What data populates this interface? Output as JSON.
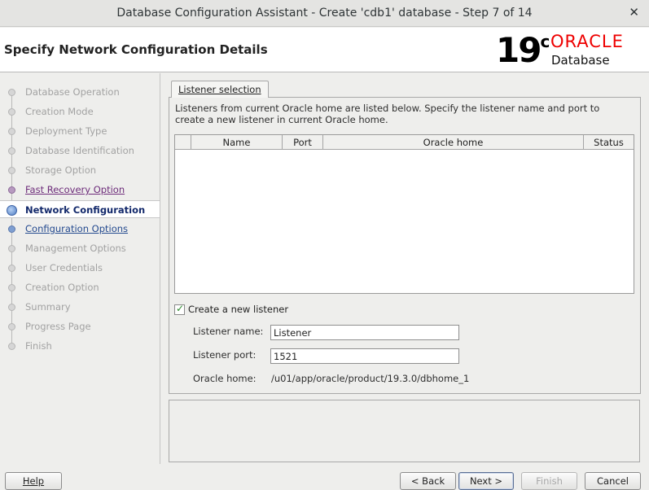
{
  "window": {
    "title": "Database Configuration Assistant - Create 'cdb1' database - Step 7 of 14",
    "close_glyph": "✕"
  },
  "header": {
    "heading": "Specify Network Configuration Details",
    "logo": {
      "version": "19",
      "version_suffix": "c",
      "brand": "ORACLE",
      "product": "Database"
    }
  },
  "nav": {
    "steps": [
      {
        "label": "Database Operation",
        "state": "disabled"
      },
      {
        "label": "Creation Mode",
        "state": "disabled"
      },
      {
        "label": "Deployment Type",
        "state": "disabled"
      },
      {
        "label": "Database Identification",
        "state": "disabled"
      },
      {
        "label": "Storage Option",
        "state": "disabled"
      },
      {
        "label": "Fast Recovery Option",
        "state": "visited"
      },
      {
        "label": "Network Configuration",
        "state": "current"
      },
      {
        "label": "Configuration Options",
        "state": "link"
      },
      {
        "label": "Management Options",
        "state": "disabled"
      },
      {
        "label": "User Credentials",
        "state": "disabled"
      },
      {
        "label": "Creation Option",
        "state": "disabled"
      },
      {
        "label": "Summary",
        "state": "disabled"
      },
      {
        "label": "Progress Page",
        "state": "disabled"
      },
      {
        "label": "Finish",
        "state": "disabled"
      }
    ]
  },
  "content": {
    "tab_label": "Listener selection",
    "description": "Listeners from current Oracle home are listed below. Specify the listener name and port to create a new listener in current Oracle home.",
    "table": {
      "columns": [
        "",
        "Name",
        "Port",
        "Oracle home",
        "Status"
      ],
      "rows": []
    },
    "create_listener": {
      "label": "Create a new listener",
      "checked": true
    },
    "listener_name": {
      "label": "Listener name:",
      "value": "Listener"
    },
    "listener_port": {
      "label": "Listener port:",
      "value": "1521"
    },
    "oracle_home": {
      "label": "Oracle home:",
      "value": "/u01/app/oracle/product/19.3.0/dbhome_1"
    }
  },
  "buttons": {
    "help": "Help",
    "back": "< Back",
    "next": "Next >",
    "finish": "Finish",
    "cancel": "Cancel"
  }
}
